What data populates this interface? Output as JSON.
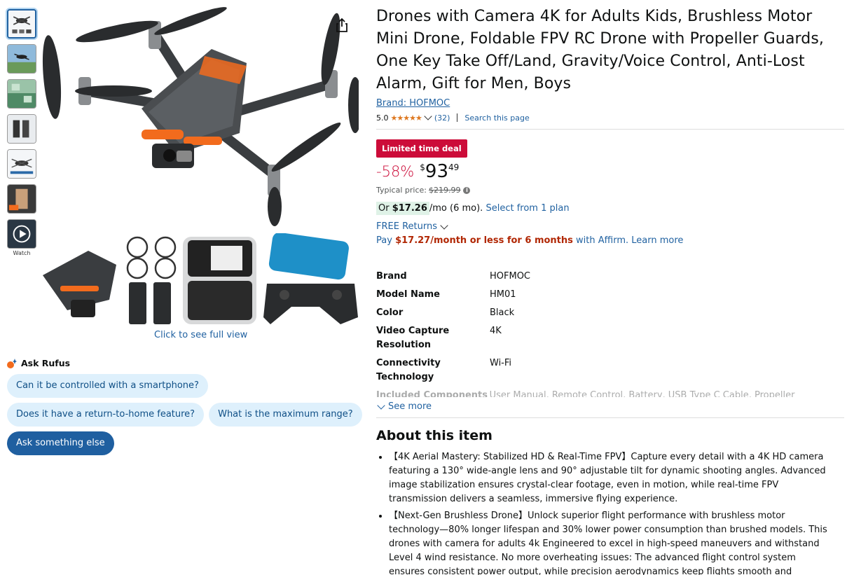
{
  "gallery": {
    "thumbnails": [
      "drone-main",
      "drone-flight",
      "drone-outdoor",
      "drone-battery",
      "drone-features",
      "drone-hand"
    ],
    "watch_label": "Watch",
    "caption": "Click to see full view"
  },
  "rufus": {
    "title": "Ask Rufus",
    "questions": [
      "Can it be controlled with a smartphone?",
      "Does it have a return-to-home feature?",
      "What is the maximum range?"
    ],
    "ask_else": "Ask something else"
  },
  "product": {
    "title": "Drones with Camera 4K for Adults Kids, Brushless Motor Mini Drone, Foldable FPV RC Drone with Propeller Guards, One Key Take Off/Land, Gravity/Voice Control, Anti-Lost Alarm, Gift for Men, Boys",
    "brand_link": "Brand: HOFMOC",
    "rating": "5.0",
    "stars": "★★★★★",
    "review_count": "(32)",
    "search_page": "Search this page"
  },
  "pricing": {
    "deal_badge": "Limited time deal",
    "discount": "-58%",
    "currency": "$",
    "price_whole": "93",
    "price_fraction": "49",
    "typical_label": "Typical price:",
    "typical_price": "$219.99",
    "info": "i",
    "affirm_prefix": "Or ",
    "affirm_amount": "$17.26",
    "affirm_term": "/mo (6 mo).",
    "affirm_link": "Select from 1 plan",
    "returns": "FREE Returns",
    "pay_prefix": "Pay ",
    "pay_amount": "$17.27/month or less for 6 months",
    "pay_suffix": " with Affirm.",
    "learn_more": "Learn more"
  },
  "specs": [
    {
      "key": "Brand",
      "value": "HOFMOC"
    },
    {
      "key": "Model Name",
      "value": "HM01"
    },
    {
      "key": "Color",
      "value": "Black"
    },
    {
      "key": "Video Capture Resolution",
      "value": "4K"
    },
    {
      "key": "Connectivity Technology",
      "value": "Wi-Fi"
    }
  ],
  "specs_faded": {
    "key": "Included Components",
    "value": "User Manual, Remote Control, Battery, USB Type C Cable, Propeller Guard"
  },
  "see_more": "See more",
  "about": {
    "title": "About this item",
    "bullets": [
      "【4K Aerial Mastery: Stabilized HD & Real-Time FPV】Capture every detail with a 4K HD camera featuring a 130° wide-angle lens and 90° adjustable tilt for dynamic shooting angles. Advanced image stabilization ensures crystal-clear footage, even in motion, while real-time FPV transmission delivers a seamless, immersive flying experience.",
      "【Next-Gen Brushless Drone】Unlock superior flight performance with brushless motor technology—80% longer lifespan and 30% lower power consumption than brushed models. This drones with camera for adults 4k Engineered to excel in high-speed maneuvers and withstand Level 4 wind resistance. No more overheating issues: The advanced flight control system ensures consistent power output, while precision aerodynamics keep flights smooth and controlled."
    ]
  },
  "colors": {
    "link": "#2162a1",
    "deal": "#cc0c39",
    "star": "#de7921",
    "chip_bg": "#def0fc",
    "chip_dark": "#1f5fa0",
    "accent_orange": "#f26b1d"
  }
}
